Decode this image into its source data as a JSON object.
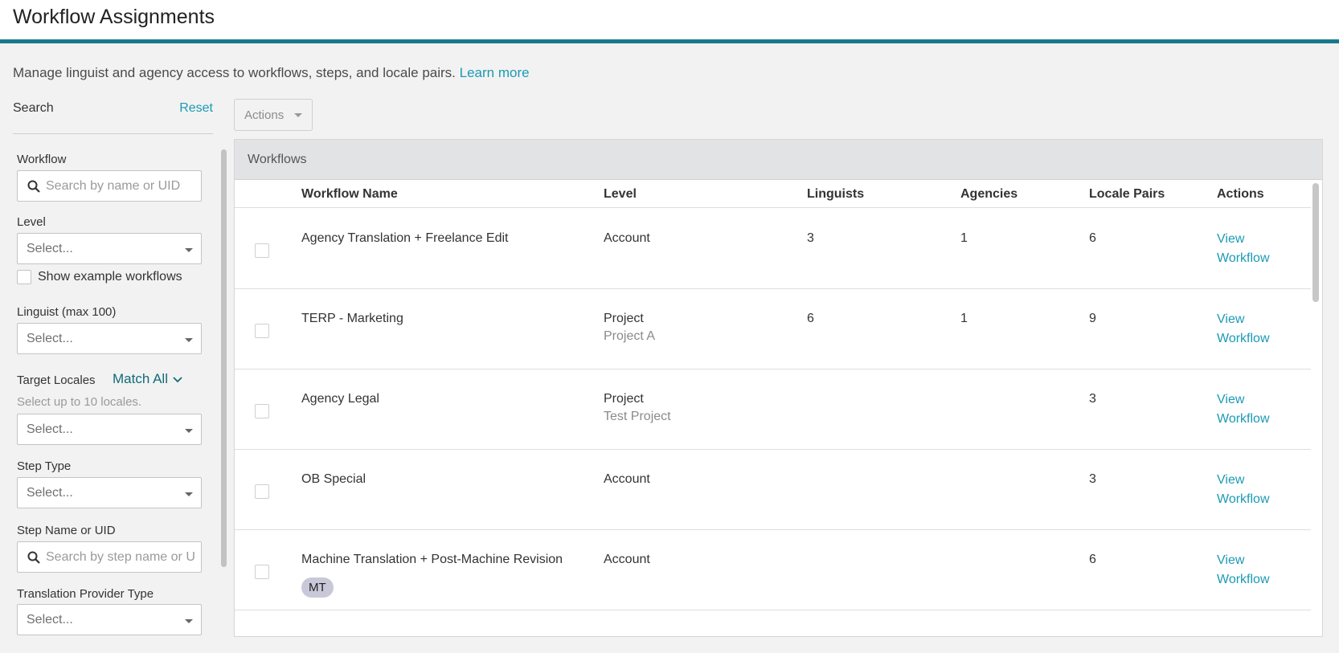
{
  "header": {
    "title": "Workflow Assignments"
  },
  "intro": {
    "text": "Manage linguist and agency access to workflows, steps, and locale pairs.",
    "link": "Learn more"
  },
  "sidebar": {
    "search_label": "Search",
    "reset_label": "Reset",
    "workflow": {
      "label": "Workflow",
      "placeholder": "Search by name or UID"
    },
    "level": {
      "label": "Level",
      "value": "Select..."
    },
    "show_examples": {
      "label": "Show example workflows",
      "checked": false
    },
    "linguist": {
      "label": "Linguist (max 100)",
      "value": "Select..."
    },
    "target_locales": {
      "label": "Target Locales",
      "match": "Match All",
      "hint": "Select up to 10 locales.",
      "value": "Select..."
    },
    "step_type": {
      "label": "Step Type",
      "value": "Select..."
    },
    "step_name": {
      "label": "Step Name or UID",
      "placeholder": "Search by step name or UID"
    },
    "provider_type": {
      "label": "Translation Provider Type",
      "value": "Select..."
    }
  },
  "toolbar": {
    "actions_label": "Actions"
  },
  "panel": {
    "title": "Workflows"
  },
  "table": {
    "columns": [
      "Workflow Name",
      "Level",
      "Linguists",
      "Agencies",
      "Locale Pairs",
      "Actions"
    ],
    "rows": [
      {
        "name": "Agency Translation + Freelance Edit",
        "level": "Account",
        "level_sub": "",
        "linguists": "3",
        "agencies": "1",
        "locale_pairs": "6",
        "action1": "View",
        "action2": "Workflow",
        "badge": ""
      },
      {
        "name": "TERP - Marketing",
        "level": "Project",
        "level_sub": "Project A",
        "linguists": "6",
        "agencies": "1",
        "locale_pairs": "9",
        "action1": "View",
        "action2": "Workflow",
        "badge": ""
      },
      {
        "name": "Agency Legal",
        "level": "Project",
        "level_sub": "Test Project",
        "linguists": "",
        "agencies": "",
        "locale_pairs": "3",
        "action1": "View",
        "action2": "Workflow",
        "badge": ""
      },
      {
        "name": "OB Special",
        "level": "Account",
        "level_sub": "",
        "linguists": "",
        "agencies": "",
        "locale_pairs": "3",
        "action1": "View",
        "action2": "Workflow",
        "badge": ""
      },
      {
        "name": "Machine Translation + Post-Machine Revision",
        "level": "Account",
        "level_sub": "",
        "linguists": "",
        "agencies": "",
        "locale_pairs": "6",
        "action1": "View",
        "action2": "Workflow",
        "badge": "MT"
      }
    ]
  },
  "colors": {
    "accent": "#167a8a",
    "link": "#1b9ab4",
    "badge_bg": "#c8c8d8"
  }
}
